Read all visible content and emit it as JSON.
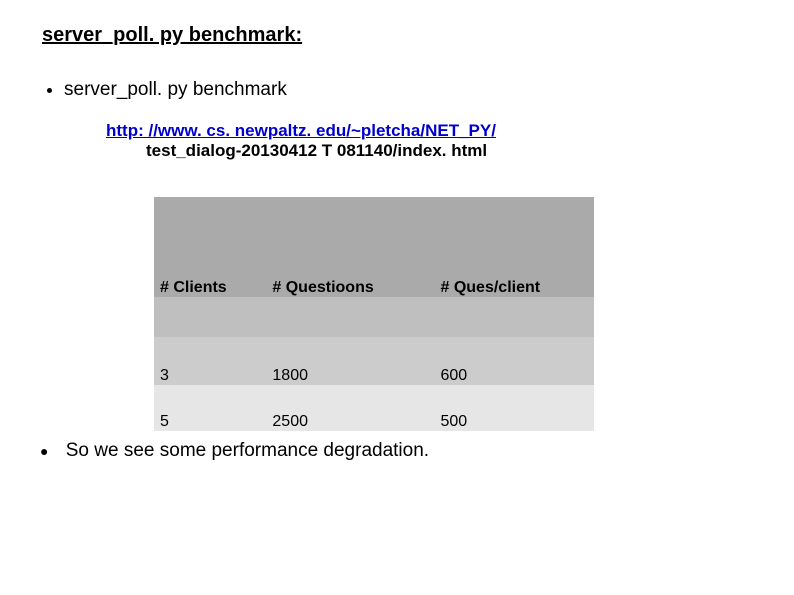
{
  "title": "server_poll. py benchmark:",
  "bullet1": "server_poll. py benchmark",
  "bullet2": "So we see some performance degradation.",
  "url": {
    "link": "http: //www. cs. newpaltz. edu/~pletcha/NET_PY/",
    "suffix": "test_dialog-20130412 T 081140/index. html"
  },
  "chart_data": {
    "type": "table",
    "columns": [
      "# Clients",
      "# Questioons",
      "# Ques/client"
    ],
    "rows": [
      [
        "3",
        "1800",
        "600"
      ],
      [
        "5",
        "2500",
        "500"
      ]
    ]
  }
}
